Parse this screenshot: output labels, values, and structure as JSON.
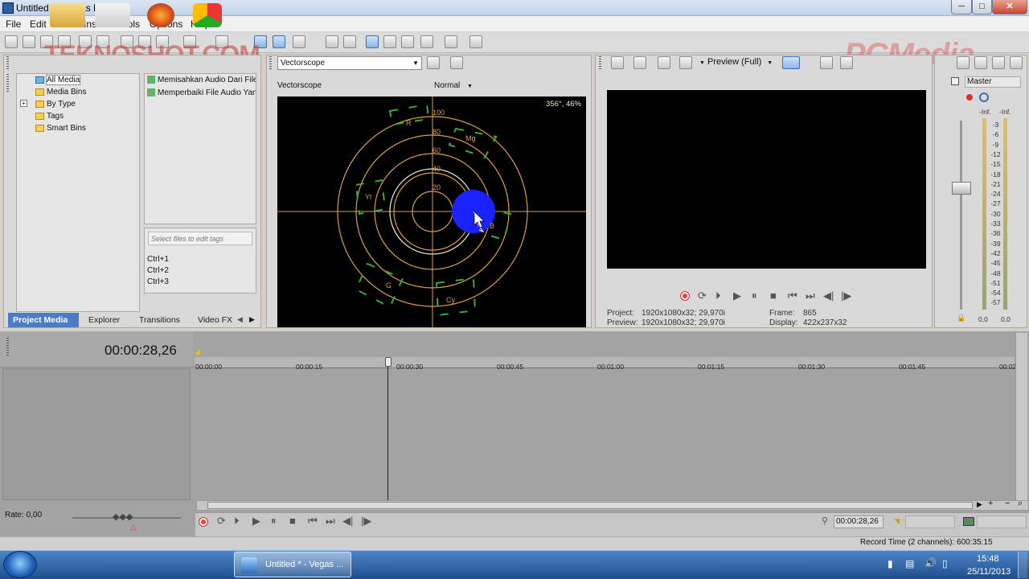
{
  "window": {
    "title": "Untitled * - Vegas Pro 12.0",
    "min": "─",
    "max": "□",
    "close": "✕"
  },
  "menu": [
    "File",
    "Edit",
    "View",
    "Insert",
    "Tools",
    "Options",
    "Help"
  ],
  "watermarks": {
    "left": "TEKNOSHOT.COM",
    "right": "PCMedia"
  },
  "project_media": {
    "tree": [
      "All Media",
      "Media Bins",
      "By Type",
      "Tags",
      "Smart Bins"
    ],
    "expand": "+",
    "files": [
      "Memisahkan Audio Dari File",
      "Memperbaiki File Audio Yan"
    ],
    "tags_placeholder": "Select files to edit tags",
    "shortcuts": [
      "Ctrl+1",
      "Ctrl+2",
      "Ctrl+3"
    ],
    "tabs": [
      "Project Media",
      "Explorer",
      "Transitions",
      "Video FX"
    ],
    "tab_arrows": [
      "◀",
      "▶"
    ]
  },
  "scope": {
    "selector": "Vectorscope",
    "panel_label": "Vectorscope",
    "mode": "Normal",
    "readout": "356°, 46%",
    "rings": [
      "100",
      "80",
      "60",
      "40",
      "20"
    ],
    "targets": [
      "R",
      "Mg",
      "Yl",
      "B",
      "G",
      "Cy"
    ]
  },
  "preview": {
    "quality": "Preview (Full)",
    "project_label": "Project:",
    "project_value": "1920x1080x32; 29,970i",
    "preview_label": "Preview:",
    "preview_value": "1920x1080x32; 29,970i",
    "frame_label": "Frame:",
    "frame_value": "865",
    "display_label": "Display:",
    "display_value": "422x237x32"
  },
  "mixer": {
    "title": "Master",
    "inf_left": "-Inf.",
    "inf_right": "-Inf.",
    "scale": [
      "3",
      "6",
      "9",
      "12",
      "15",
      "18",
      "21",
      "24",
      "27",
      "30",
      "33",
      "36",
      "39",
      "42",
      "45",
      "48",
      "51",
      "54",
      "57"
    ],
    "val_left": "0,0",
    "val_right": "0,0"
  },
  "timeline": {
    "timecode": "00:00:28,26",
    "ruler": [
      "00:00:00",
      "00:00:15",
      "00:00:30",
      "00:00:45",
      "00:01:00",
      "00:01:15",
      "00:01:30",
      "00:01:45",
      "00:02"
    ],
    "rate": "Rate: 0,00",
    "cursor_time": "00:00:28,26",
    "zoom_buttons": [
      "▶",
      "+",
      "−",
      "⌕"
    ]
  },
  "statusbar": {
    "record_time": "Record Time (2 channels): 600:35:15"
  },
  "taskbar": {
    "active_task": "Untitled * - Vegas ...",
    "time": "15:48",
    "date": "25/11/2013"
  }
}
